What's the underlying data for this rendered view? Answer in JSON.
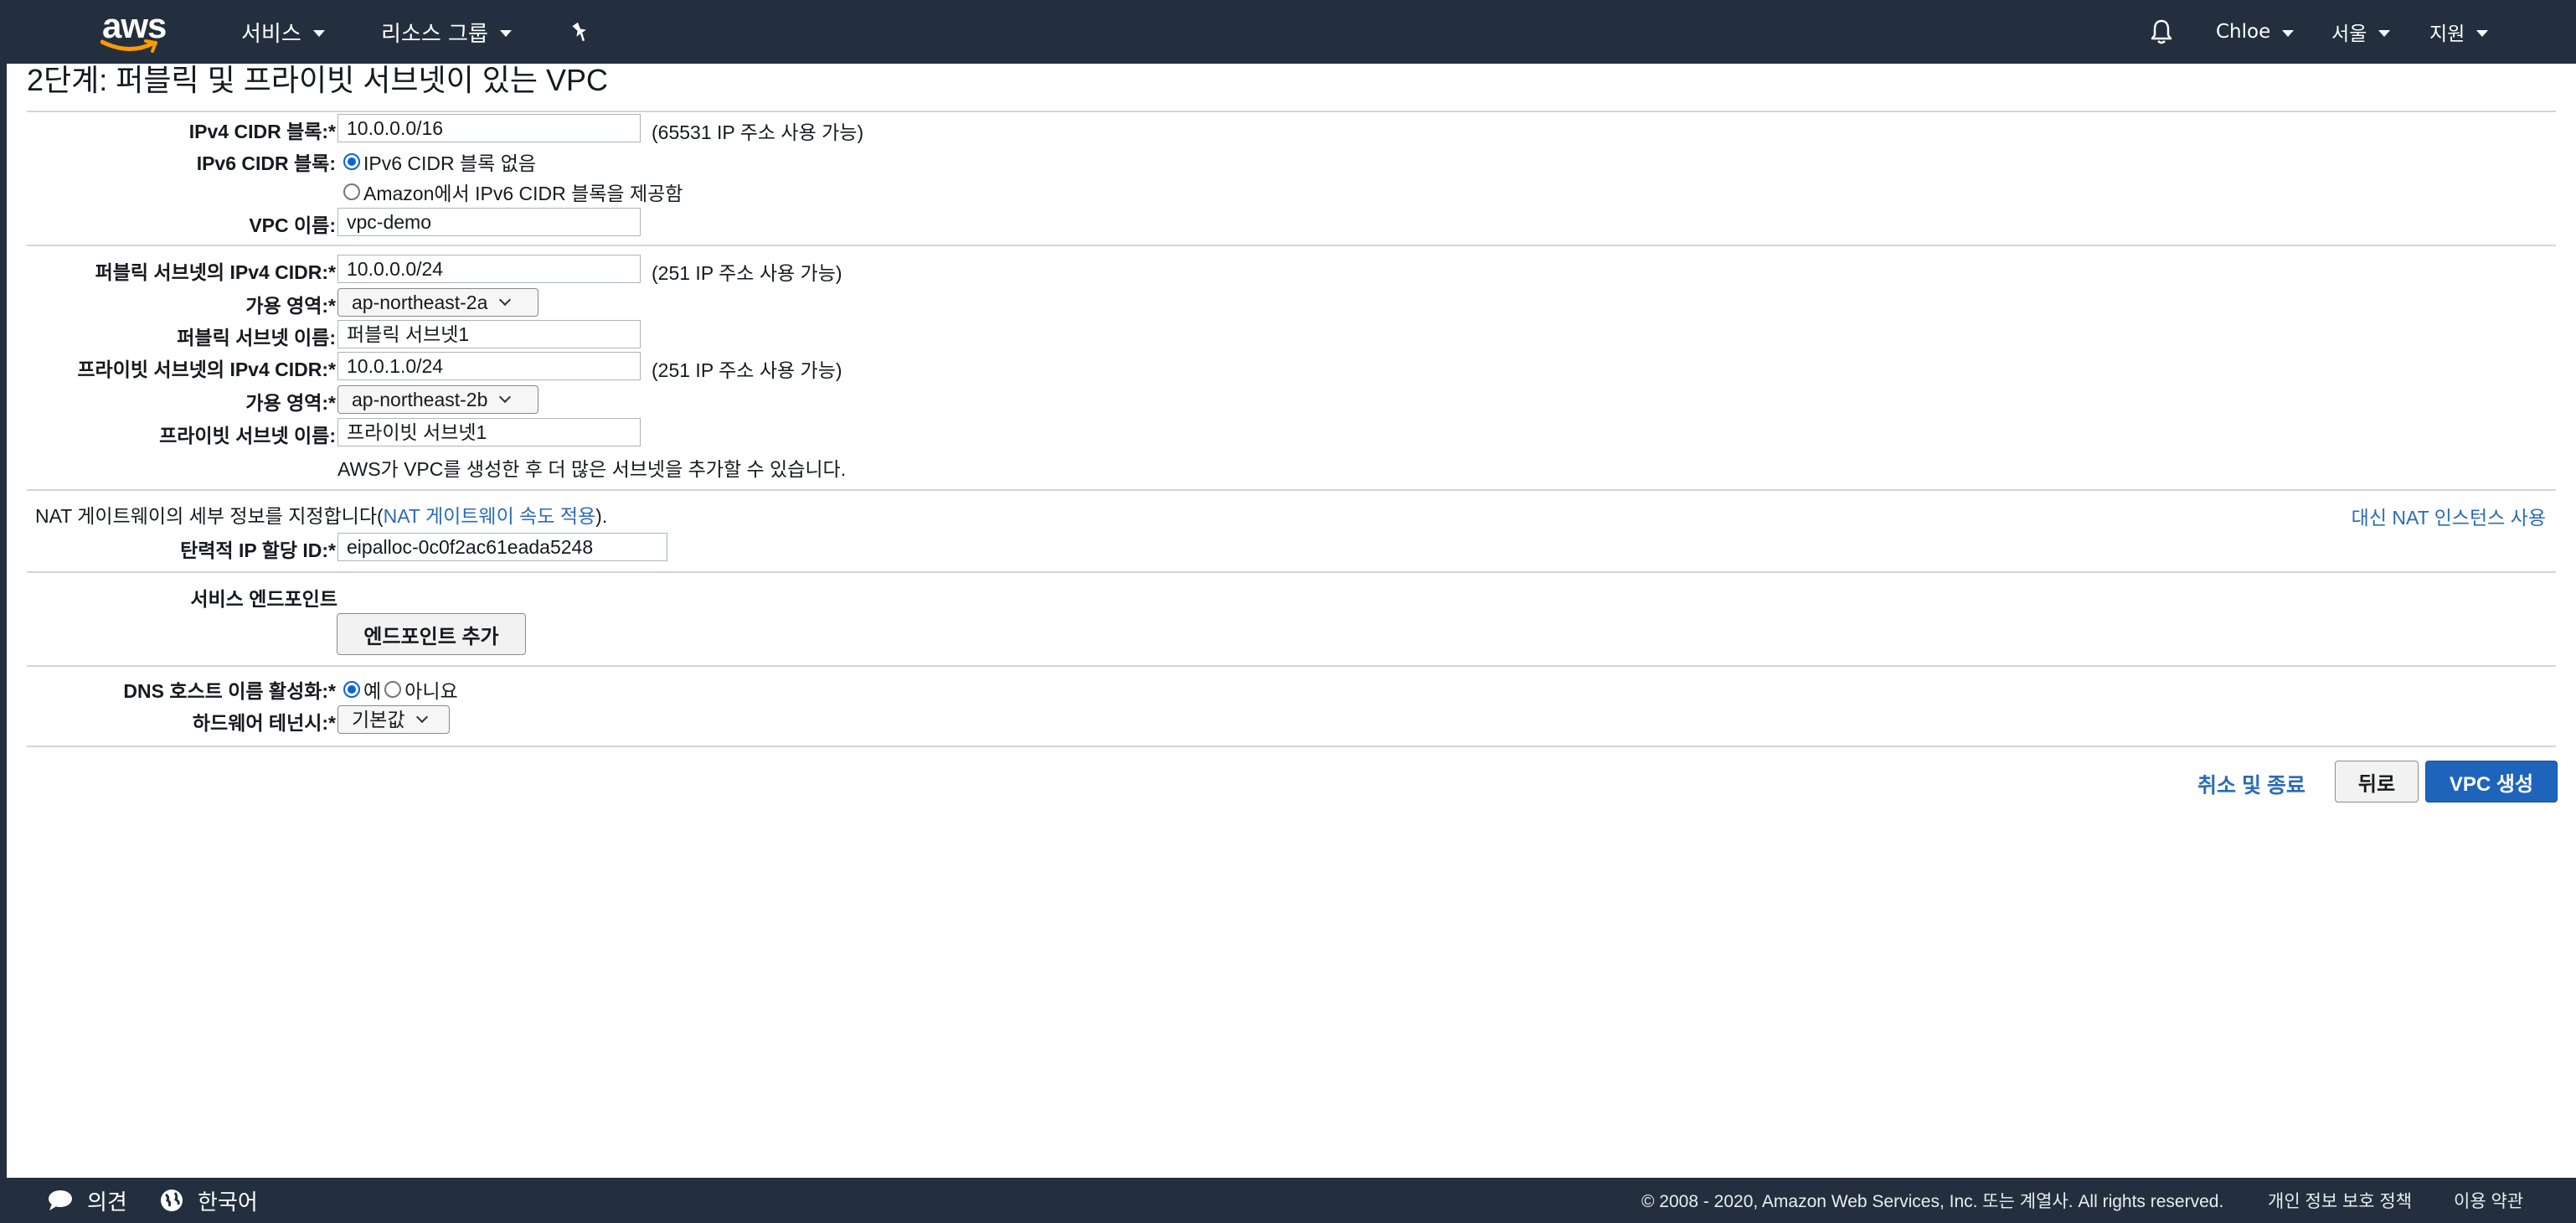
{
  "nav": {
    "logo": "aws",
    "services": "서비스",
    "resource_groups": "리소스 그룹",
    "user": "Chloe",
    "region": "서울",
    "support": "지원",
    "icons": [
      "pin-icon",
      "bell-icon"
    ]
  },
  "page": {
    "title": "2단계: 퍼블릭 및 프라이빗 서브넷이 있는 VPC"
  },
  "vpc": {
    "ipv4_label": "IPv4 CIDR 블록:*",
    "ipv4_value": "10.0.0.0/16",
    "ipv4_hint": "(65531 IP 주소 사용 가능)",
    "ipv6_label": "IPv6 CIDR 블록:",
    "ipv6_opt_none": "IPv6 CIDR 블록 없음",
    "ipv6_opt_amazon": "Amazon에서 IPv6 CIDR 블록을 제공함",
    "ipv6_selected": "none",
    "name_label": "VPC 이름:",
    "name_value": "vpc-demo"
  },
  "subnets": {
    "public_cidr_label": "퍼블릭 서브넷의 IPv4 CIDR:*",
    "public_cidr_value": "10.0.0.0/24",
    "public_cidr_hint": "(251 IP 주소 사용 가능)",
    "public_az_label": "가용 영역:*",
    "public_az_value": "ap-northeast-2a",
    "public_name_label": "퍼블릭 서브넷 이름:",
    "public_name_value": "퍼블릭 서브넷1",
    "private_cidr_label": "프라이빗 서브넷의 IPv4 CIDR:*",
    "private_cidr_value": "10.0.1.0/24",
    "private_cidr_hint": "(251 IP 주소 사용 가능)",
    "private_az_label": "가용 영역:*",
    "private_az_value": "ap-northeast-2b",
    "private_name_label": "프라이빗 서브넷 이름:",
    "private_name_value": "프라이빗 서브넷1",
    "note": "AWS가 VPC를 생성한 후 더 많은 서브넷을 추가할 수 있습니다."
  },
  "nat": {
    "intro_prefix": "NAT 게이트웨이의 세부 정보를 지정합니다(",
    "rate_link": "NAT 게이트웨이 속도 적용",
    "intro_suffix": ").",
    "instance_link": "대신 NAT 인스턴스 사용",
    "eip_label": "탄력적 IP 할당 ID:*",
    "eip_value": "eipalloc-0c0f2ac61eada5248"
  },
  "endpoints": {
    "label": "서비스 엔드포인트",
    "add_button": "엔드포인트 추가"
  },
  "dns": {
    "label": "DNS 호스트 이름 활성화:*",
    "yes": "예",
    "no": "아니요",
    "selected": "yes",
    "tenancy_label": "하드웨어 테넌시:*",
    "tenancy_value": "기본값"
  },
  "actions": {
    "cancel": "취소 및 종료",
    "back": "뒤로",
    "create": "VPC 생성"
  },
  "footer": {
    "feedback": "의견",
    "language": "한국어",
    "copyright": "© 2008 - 2020, Amazon Web Services, Inc. 또는 계열사. All rights reserved.",
    "privacy": "개인 정보 보호 정책",
    "terms": "이용 약관",
    "icons": [
      "feedback-icon",
      "globe-icon"
    ]
  }
}
